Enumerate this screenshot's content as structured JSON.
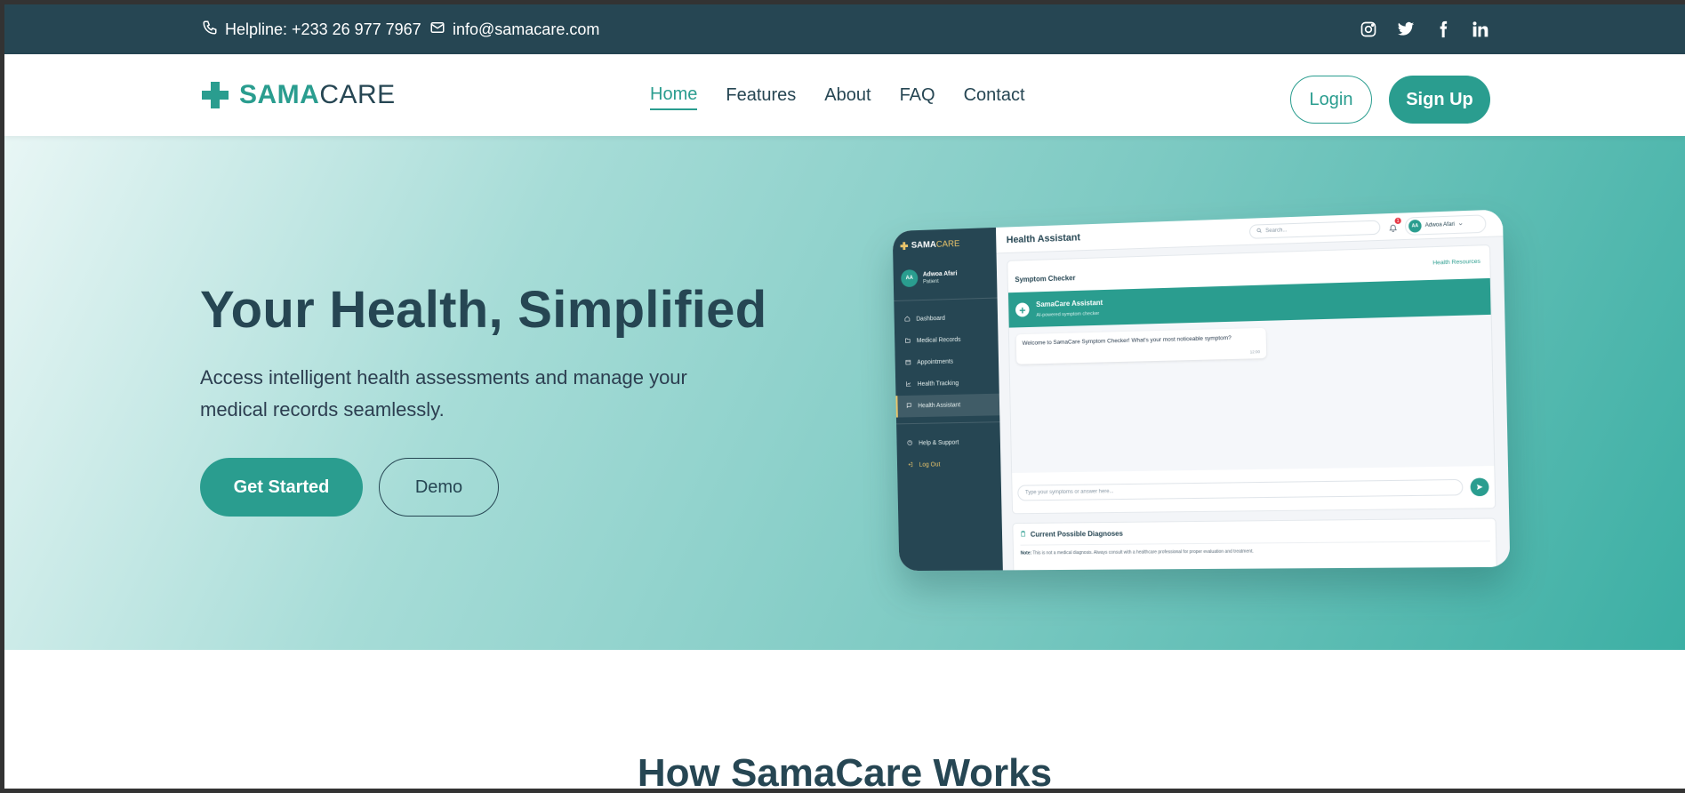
{
  "topbar": {
    "phone": "Helpline: +233 26 977 7967",
    "email": "info@samacare.com",
    "socials": [
      "instagram-icon",
      "twitter-icon",
      "facebook-icon",
      "linkedin-icon"
    ]
  },
  "brand": {
    "sama": "SAMA",
    "care": "CARE"
  },
  "nav": {
    "items": [
      "Home",
      "Features",
      "About",
      "FAQ",
      "Contact"
    ],
    "active": "Home",
    "login": "Login",
    "signup": "Sign Up"
  },
  "hero": {
    "title": "Your Health, Simplified",
    "subtitle": "Access intelligent health assessments and manage your medical records seamlessly.",
    "cta_primary": "Get Started",
    "cta_secondary": "Demo"
  },
  "mockup": {
    "logo_sama": "SAMA",
    "logo_care": "CARE",
    "user_initials": "AA",
    "user_name": "Adwoa Afari",
    "user_role": "Patient",
    "menu": [
      "Dashboard",
      "Medical Records",
      "Appointments",
      "Health Tracking",
      "Health Assistant"
    ],
    "help": "Help & Support",
    "logout": "Log Out",
    "page_title": "Health Assistant",
    "search_placeholder": "Search...",
    "notification_count": "1",
    "profile_name": "Adwoa Afari",
    "card_title": "Symptom Checker",
    "resources_link": "Health Resources",
    "assistant_title": "SamaCare Assistant",
    "assistant_sub": "AI-powered symptom checker",
    "welcome_message": "Welcome to SamaCare Symptom Checker! What's your most noticeable symptom?",
    "message_time": "12:00",
    "input_placeholder": "Type your symptoms or answer here...",
    "diagnoses_title": "Current Possible Diagnoses",
    "note_label": "Note:",
    "note_text": "This is not a medical diagnosis. Always consult with a healthcare professional for proper evaluation and treatment."
  },
  "section": {
    "title": "How SamaCare Works"
  },
  "colors": {
    "primary": "#2a9d8f",
    "dark": "#264653",
    "accent": "#e9c46a"
  }
}
